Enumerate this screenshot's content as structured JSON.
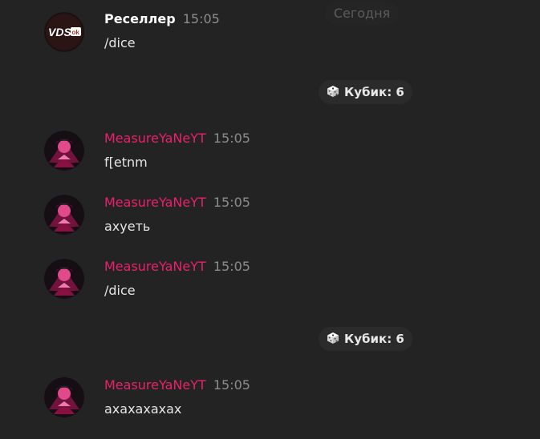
{
  "date_separator": "Сегодня",
  "messages": [
    {
      "author": "Реселлер",
      "time": "15:05",
      "text": "/dice",
      "avatar": "vds-logo-avatar"
    },
    {
      "author": "MeasureYaNeYT",
      "time": "15:05",
      "text": "f[etnm",
      "avatar": "pink-character-avatar"
    },
    {
      "author": "MeasureYaNeYT",
      "time": "15:05",
      "text": "ахуеть",
      "avatar": "pink-character-avatar"
    },
    {
      "author": "MeasureYaNeYT",
      "time": "15:05",
      "text": "/dice",
      "avatar": "pink-character-avatar"
    },
    {
      "author": "MeasureYaNeYT",
      "time": "15:05",
      "text": "ахахахахах",
      "avatar": "pink-character-avatar"
    }
  ],
  "dice_results": [
    {
      "label": "Кубик: 6",
      "icon": "dice-icon"
    },
    {
      "label": "Кубик: 6",
      "icon": "dice-icon"
    }
  ],
  "avatar_logo_text": {
    "main": "VDS",
    "sub": "ok"
  },
  "colors": {
    "background": "#232323",
    "username_pink": "#e8226b",
    "timestamp": "#8d8d8d",
    "service_bg": "#2b2b2b"
  }
}
